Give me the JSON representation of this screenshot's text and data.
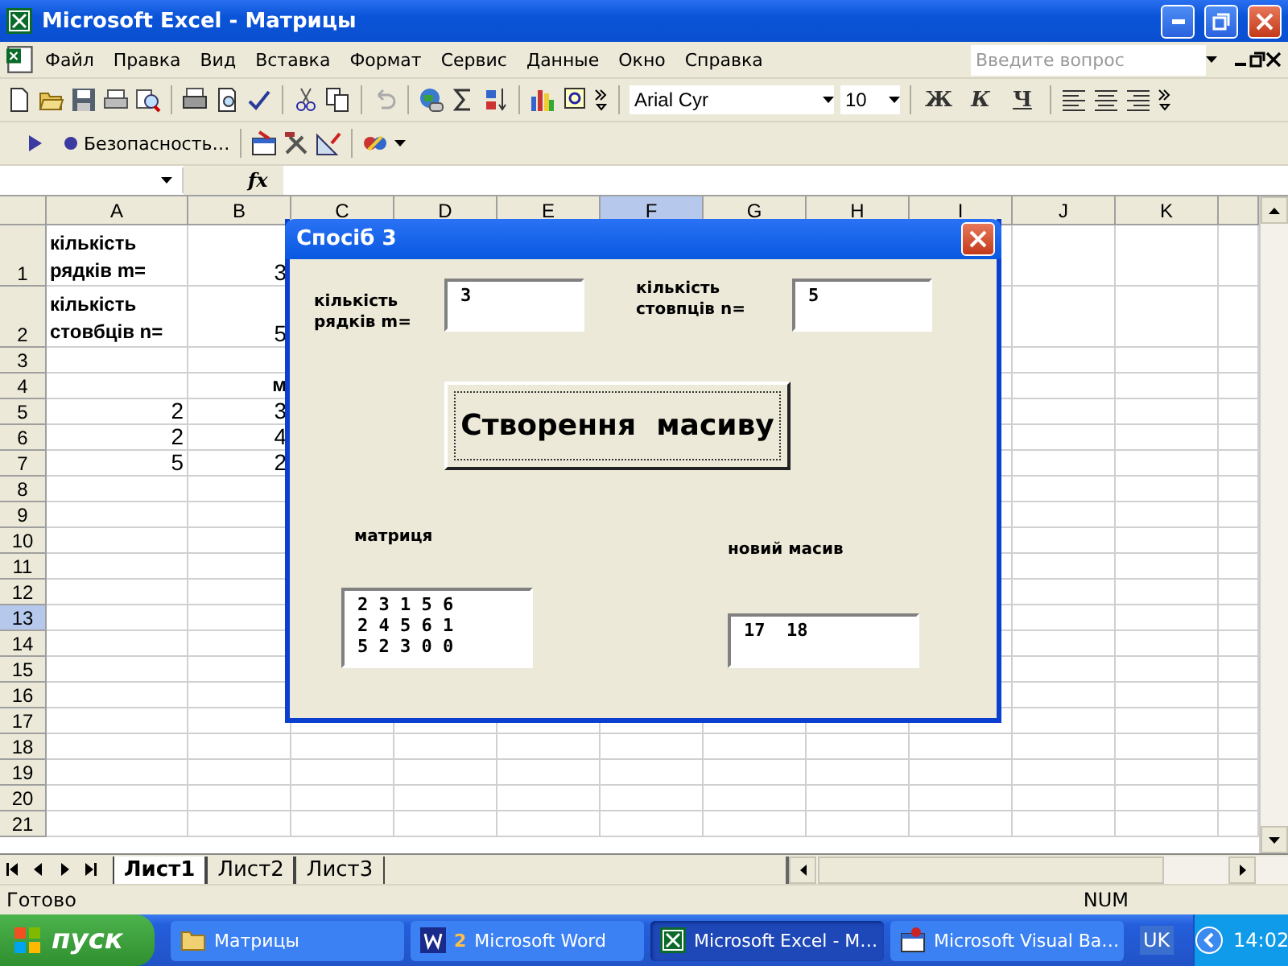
{
  "window": {
    "title": "Microsoft Excel - Матрицы"
  },
  "menu": {
    "items": [
      "Файл",
      "Правка",
      "Вид",
      "Вставка",
      "Формат",
      "Сервис",
      "Данные",
      "Окно",
      "Справка"
    ],
    "question": {
      "placeholder": "Введите вопрос"
    }
  },
  "formatting": {
    "font": "Arial Cyr",
    "size": "10",
    "styles": [
      "Ж",
      "К",
      "Ч"
    ]
  },
  "toolbar2": {
    "security": "Безопасность…"
  },
  "formula_bar": {
    "fx": "fx"
  },
  "sheet": {
    "columns": [
      {
        "label": "A",
        "selected": false
      },
      {
        "label": "B",
        "selected": false
      },
      {
        "label": "C",
        "selected": false
      },
      {
        "label": "D",
        "selected": false
      },
      {
        "label": "E",
        "selected": false
      },
      {
        "label": "F",
        "selected": true
      },
      {
        "label": "G",
        "selected": false
      },
      {
        "label": "H",
        "selected": false
      },
      {
        "label": "I",
        "selected": false
      },
      {
        "label": "J",
        "selected": false
      },
      {
        "label": "K",
        "selected": false
      }
    ],
    "rows": [
      {
        "label": "1",
        "selected": false,
        "a": {
          "text": "кількість рядків m=",
          "kind": "label"
        },
        "b": {
          "text": "3",
          "kind": "number"
        }
      },
      {
        "label": "2",
        "selected": false,
        "a": {
          "text": "кількість стовбців n=",
          "kind": "label"
        },
        "b": {
          "text": "5",
          "kind": "number"
        }
      },
      {
        "label": "3",
        "selected": false
      },
      {
        "label": "4",
        "selected": false,
        "b": {
          "text": "м",
          "kind": "merged"
        }
      },
      {
        "label": "5",
        "selected": false,
        "a": {
          "text": "2",
          "kind": "number"
        },
        "b": {
          "text": "3",
          "kind": "number"
        }
      },
      {
        "label": "6",
        "selected": false,
        "a": {
          "text": "2",
          "kind": "number"
        },
        "b": {
          "text": "4",
          "kind": "number"
        }
      },
      {
        "label": "7",
        "selected": false,
        "a": {
          "text": "5",
          "kind": "number"
        },
        "b": {
          "text": "2",
          "kind": "number"
        }
      },
      {
        "label": "8",
        "selected": false
      },
      {
        "label": "9",
        "selected": false
      },
      {
        "label": "10",
        "selected": false
      },
      {
        "label": "11",
        "selected": false
      },
      {
        "label": "12",
        "selected": false
      },
      {
        "label": "13",
        "selected": true
      },
      {
        "label": "14",
        "selected": false
      },
      {
        "label": "15",
        "selected": false
      },
      {
        "label": "16",
        "selected": false
      },
      {
        "label": "17",
        "selected": false
      },
      {
        "label": "18",
        "selected": false
      },
      {
        "label": "19",
        "selected": false
      },
      {
        "label": "20",
        "selected": false
      },
      {
        "label": "21",
        "selected": false
      }
    ]
  },
  "sheet_tabs": [
    {
      "label": "Лист1",
      "selected": true
    },
    {
      "label": "Лист2",
      "selected": false
    },
    {
      "label": "Лист3",
      "selected": false
    }
  ],
  "status_bar": {
    "status": "Готово",
    "num": "NUM"
  },
  "dialog": {
    "title": "Спосіб 3",
    "rows_label": "кількість рядків m=",
    "rows_value": "3",
    "cols_label": "кількість стовпців n=",
    "cols_value": "5",
    "button": "Створення  масиву",
    "matrix_label": "матриця",
    "matrix_lines": [
      "2 3 1 5 6",
      "2 4 5 6 1",
      "5 2 3 0 0"
    ],
    "result_label": "новий масив",
    "result_value": "17  18"
  },
  "taskbar": {
    "start": "пуск",
    "tasks": [
      {
        "label": "Матрицы",
        "kind": "folder",
        "selected": false
      },
      {
        "label": "Microsoft Word",
        "count": "2",
        "kind": "word",
        "selected": false
      },
      {
        "label": "Microsoft Excel - M…",
        "kind": "excel",
        "selected": true
      },
      {
        "label": "Microsoft Visual Ba…",
        "kind": "vba",
        "selected": false
      }
    ],
    "language": "UK",
    "clock": "14:02"
  }
}
